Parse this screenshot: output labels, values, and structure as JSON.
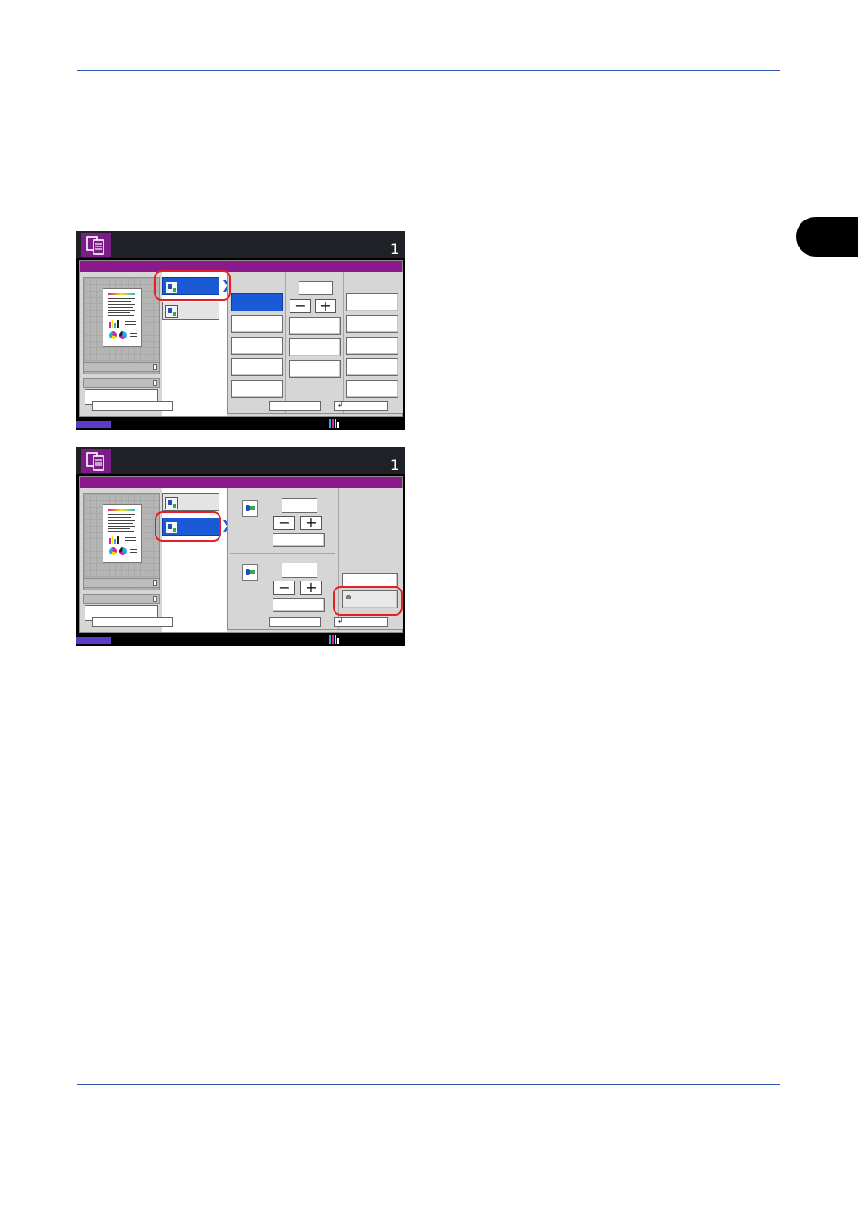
{
  "page": {
    "chapter_tab": "",
    "header_rule_color": "#2d5aa8"
  },
  "screen1": {
    "copies": "1",
    "title_bar_color": "#8a1a8c"
  },
  "screen2": {
    "copies": "1",
    "title_bar_color": "#8a1a8c"
  },
  "icons": {
    "copy_mode": "copy-icon",
    "highlight": "red-rounded-rectangle"
  },
  "colors": {
    "selected": "#1a5ad6",
    "highlight_ring": "#e21f26",
    "status_accent": "#5a3cc8"
  }
}
